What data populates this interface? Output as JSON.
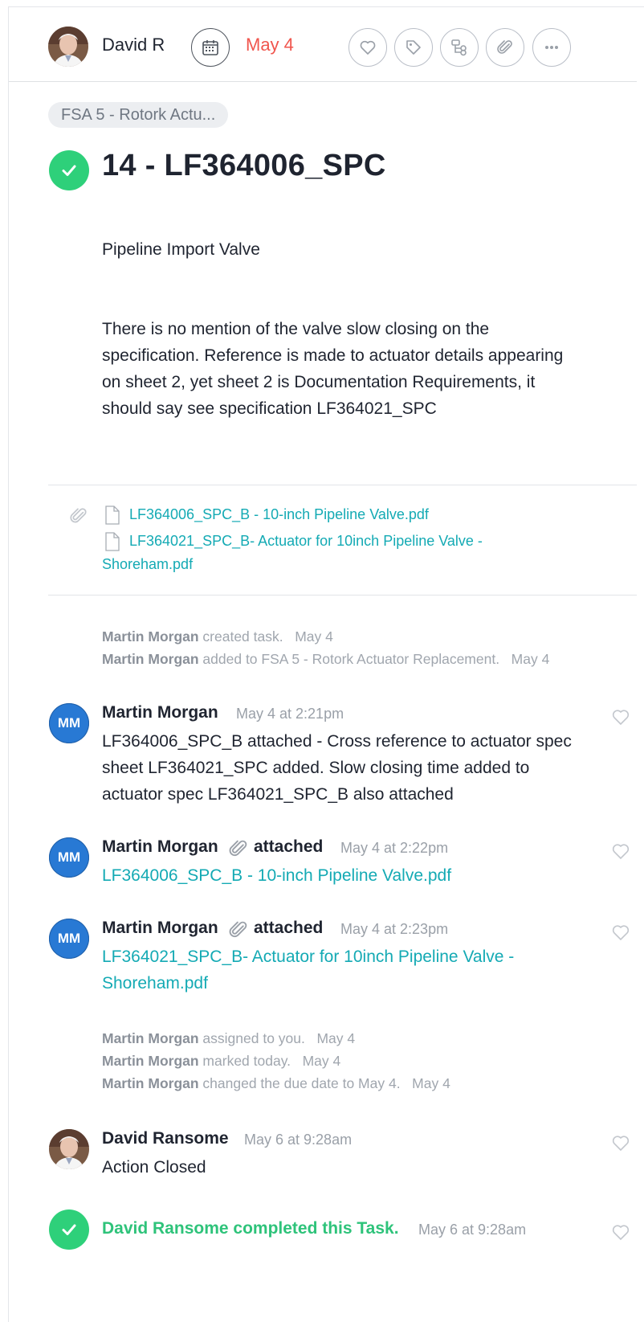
{
  "header": {
    "assignee_name": "David R",
    "due_date": "May 4",
    "icons": [
      "calendar-icon",
      "heart-icon",
      "tag-icon",
      "subtask-icon",
      "paperclip-icon",
      "more-icon"
    ]
  },
  "breadcrumb": "FSA 5 - Rotork Actu...",
  "task": {
    "title": "14 - LF364006_SPC",
    "subtitle": "Pipeline Import Valve",
    "description_lines": [
      "There is no mention of the valve slow closing on the",
      "specification. Reference is made to actuator details appearing",
      "on sheet 2, yet sheet 2 is Documentation Requirements, it",
      "should say see specification LF364021_SPC"
    ]
  },
  "attachments": {
    "file1": "LF364006_SPC_B - 10-inch Pipeline Valve.pdf",
    "file2_line1": "LF364021_SPC_B- Actuator for 10inch Pipeline Valve -",
    "file2_line2": "Shoreham.pdf"
  },
  "activity_top": [
    {
      "author": "Martin Morgan",
      "action": " created task.",
      "time": "May 4"
    },
    {
      "author": "Martin Morgan",
      "action": " added to FSA 5 - Rotork Actuator Replacement.",
      "time": "May 4"
    }
  ],
  "comments": [
    {
      "initials": "MM",
      "author": "Martin Morgan",
      "time": "May 4 at 2:21pm",
      "lines": [
        "LF364006_SPC_B attached - Cross reference to actuator spec",
        "sheet LF364021_SPC added. Slow closing time added to",
        "actuator spec LF364021_SPC_B also attached"
      ]
    },
    {
      "initials": "MM",
      "author": "Martin Morgan",
      "verb": "attached",
      "time": "May 4 at 2:22pm",
      "link": "LF364006_SPC_B - 10-inch Pipeline Valve.pdf"
    },
    {
      "initials": "MM",
      "author": "Martin Morgan",
      "verb": "attached",
      "time": "May 4 at 2:23pm",
      "link_line1": "LF364021_SPC_B- Actuator for 10inch Pipeline Valve -",
      "link_line2": "Shoreham.pdf"
    }
  ],
  "activity_mid": [
    {
      "author": "Martin Morgan",
      "action": " assigned to you.",
      "time": "May 4"
    },
    {
      "author": "Martin Morgan",
      "action": " marked today.",
      "time": "May 4"
    },
    {
      "author": "Martin Morgan",
      "action": " changed the due date to May 4.",
      "time": "May 4"
    }
  ],
  "final_comment": {
    "author": "David Ransome",
    "time": "May 6 at 9:28am",
    "text": "Action Closed"
  },
  "completion": {
    "text": "David Ransome completed this Task.",
    "time": "May 6 at 9:28am"
  },
  "colors": {
    "accent_link": "#14aab4",
    "due_red": "#f0554d",
    "complete_green": "#2ed07a",
    "avatar_blue": "#2879d4"
  }
}
